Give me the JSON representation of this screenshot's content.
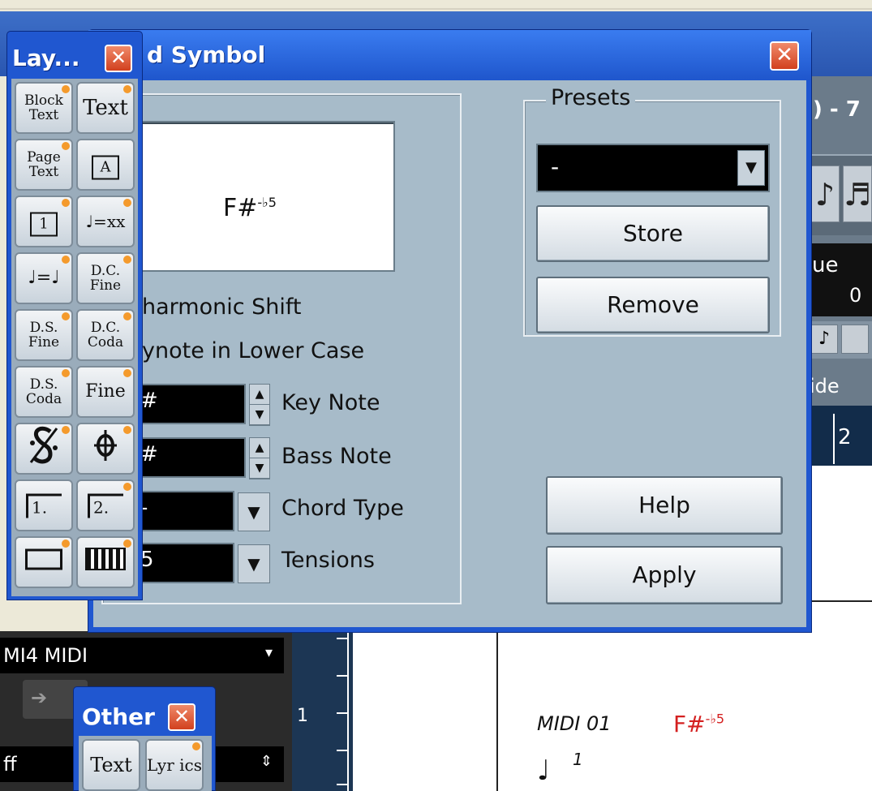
{
  "background": {
    "window_title_fragment": ") - 7",
    "value_fragment": "ue",
    "value_number": "0",
    "side_label": "ide",
    "ruler_number": "2",
    "track_names": [
      "MI4 MIDI",
      "ff"
    ],
    "left_ruler_number": "1",
    "score": {
      "track_label": "MIDI 01",
      "chord_root": "F#",
      "chord_ext": "-♭5",
      "note_number": "1"
    }
  },
  "dialog": {
    "title": "d Symbol",
    "preview": {
      "chord_root": "F#",
      "chord_ext": "-♭5"
    },
    "enharmonic_label": "harmonic Shift",
    "lowercase_label": "ynote in Lower Case",
    "key_note": {
      "value": "#",
      "label": "Key Note"
    },
    "bass_note": {
      "value": "#",
      "label": "Bass Note"
    },
    "chord_type": {
      "value": "-",
      "label": "Chord Type"
    },
    "tensions": {
      "value": "5",
      "label": "Tensions"
    },
    "presets": {
      "legend": "Presets",
      "selected": "-",
      "store_label": "Store",
      "remove_label": "Remove"
    },
    "help_label": "Help",
    "apply_label": "Apply"
  },
  "layout_palette": {
    "title": "Lay...",
    "tools": [
      {
        "label": "Block Text"
      },
      {
        "label": "Text"
      },
      {
        "label": "Page Text"
      },
      {
        "label": "A"
      },
      {
        "label": "1"
      },
      {
        "label": "♩=xx"
      },
      {
        "label": "♩=♩"
      },
      {
        "label": "D.C. Fine"
      },
      {
        "label": "D.S. Fine"
      },
      {
        "label": "D.C. Coda"
      },
      {
        "label": "D.S. Coda"
      },
      {
        "label": "Fine"
      },
      {
        "label": "𝄋"
      },
      {
        "label": "𝄌"
      },
      {
        "label": "1."
      },
      {
        "label": "2."
      },
      {
        "label": "box"
      },
      {
        "label": "keyboard"
      }
    ]
  },
  "other_palette": {
    "title": "Other",
    "tools": [
      {
        "label": "Text"
      },
      {
        "label": "Lyr ics"
      }
    ]
  }
}
